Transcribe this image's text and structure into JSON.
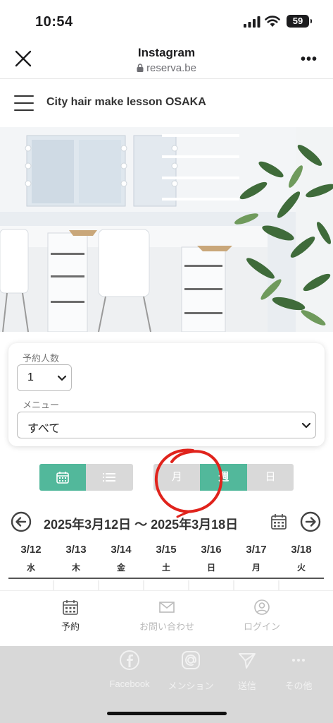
{
  "status_bar": {
    "time": "10:54",
    "battery": "59"
  },
  "browser": {
    "title": "Instagram",
    "url": "reserva.be"
  },
  "site": {
    "title": "City hair make lesson OSAKA"
  },
  "form": {
    "people_label": "予約人数",
    "people_value": "1",
    "menu_label": "メニュー",
    "menu_value": "すべて"
  },
  "range_toggle": {
    "month": "月",
    "week": "週",
    "day": "日",
    "active": "週"
  },
  "date_nav": {
    "range": "2025年3月12日 〜 2025年3月18日"
  },
  "days": [
    {
      "date": "3/12",
      "weekday": "水"
    },
    {
      "date": "3/13",
      "weekday": "木"
    },
    {
      "date": "3/14",
      "weekday": "金"
    },
    {
      "date": "3/15",
      "weekday": "土"
    },
    {
      "date": "3/16",
      "weekday": "日"
    },
    {
      "date": "3/17",
      "weekday": "月"
    },
    {
      "date": "3/18",
      "weekday": "火"
    }
  ],
  "bottom_nav": {
    "reserve": "予約",
    "contact": "お問い合わせ",
    "login": "ログイン"
  },
  "share_bar": {
    "facebook": "Facebook",
    "mention": "メンション",
    "send": "送信",
    "other": "その他"
  },
  "colors": {
    "accent": "#52b89b",
    "annotation": "#e0231c",
    "inactive": "#d9d9d9"
  }
}
